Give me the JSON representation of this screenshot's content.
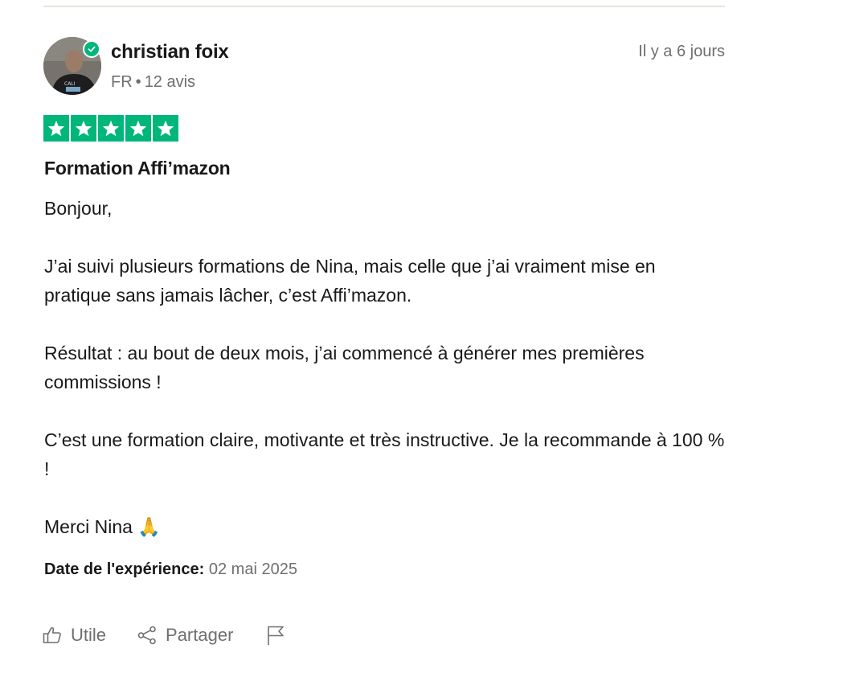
{
  "review": {
    "author_name": "christian foix",
    "country": "FR",
    "separator": "•",
    "review_count": "12 avis",
    "age": "Il y a 6 jours",
    "rating": 5,
    "title": "Formation Affi’mazon",
    "body": [
      "Bonjour,",
      "",
      "J’ai suivi plusieurs formations de Nina, mais celle que j’ai vraiment mise en pratique sans jamais lâcher, c’est Affi’mazon.",
      "",
      "Résultat : au bout de deux mois, j’ai commencé à générer mes premières commissions !",
      "",
      "C’est une formation claire, motivante et très instructive. Je la recommande à 100 % !",
      "",
      "Merci Nina 🙏"
    ],
    "experience_label": "Date de l'expérience:",
    "experience_date": "02 mai 2025"
  },
  "actions": {
    "useful_label": "Utile",
    "share_label": "Partager"
  },
  "icons": {
    "verified": "verified-check-icon",
    "star": "star-icon",
    "useful": "thumbs-up-icon",
    "share": "share-icon",
    "report": "flag-icon"
  },
  "colors": {
    "star_green": "#00b67a",
    "text_primary": "#191919",
    "text_secondary": "#6f6f6f"
  }
}
